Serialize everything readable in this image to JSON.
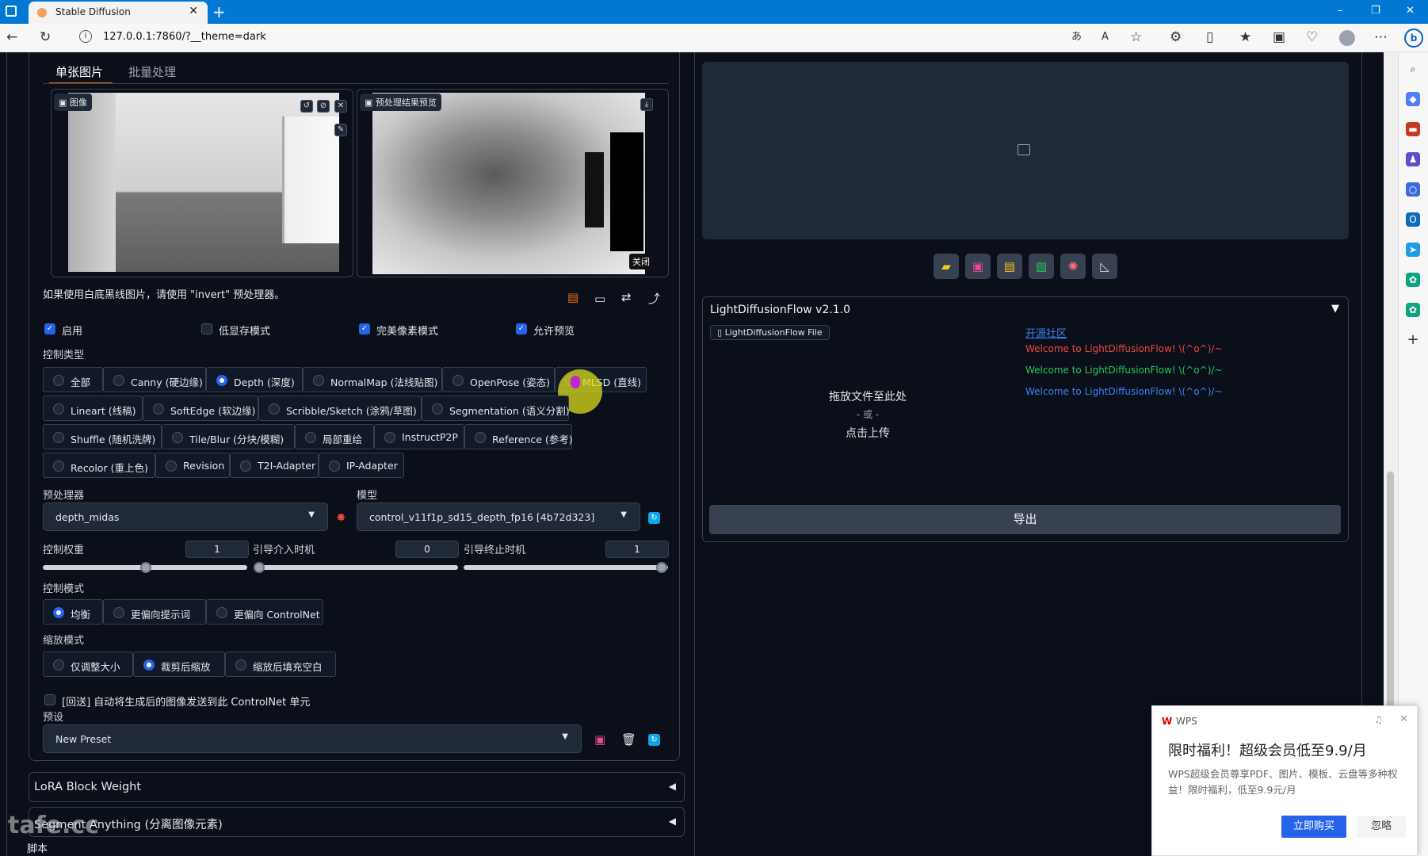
{
  "browser": {
    "tab_title": "Stable Diffusion",
    "new_tab": "+",
    "address": "127.0.0.1:7860/?__theme=dark",
    "nav_icons": [
      "back-icon",
      "refresh-icon",
      "info-icon"
    ],
    "window_buttons": [
      "–",
      "❐",
      "✕"
    ]
  },
  "left": {
    "tabs": [
      "单张图片",
      "批量处理"
    ],
    "image_label": "图像",
    "preview_label": "预处理结果预览",
    "close_label": "关闭",
    "hint": "如果使用白底黑线图片，请使用 \"invert\" 预处理器。",
    "checkboxes": [
      {
        "label": "启用",
        "checked": true
      },
      {
        "label": "低显存模式",
        "checked": false
      },
      {
        "label": "完美像素模式",
        "checked": true
      },
      {
        "label": "允许预览",
        "checked": true
      }
    ],
    "control_type_label": "控制类型",
    "control_types": [
      [
        "全部",
        "Canny (硬边缘)",
        "Depth (深度)",
        "NormalMap (法线贴图)",
        "OpenPose (姿态)",
        "MLSD (直线)"
      ],
      [
        "Lineart (线稿)",
        "SoftEdge (软边缘)",
        "Scribble/Sketch (涂鸦/草图)",
        "Segmentation (语义分割)"
      ],
      [
        "Shuffle (随机洗牌)",
        "Tile/Blur (分块/模糊)",
        "局部重绘",
        "InstructP2P",
        "Reference (参考)"
      ],
      [
        "Recolor (重上色)",
        "Revision",
        "T2I-Adapter",
        "IP-Adapter"
      ]
    ],
    "control_type_selected": "Depth (深度)",
    "preprocessor_label": "预处理器",
    "preprocessor_value": "depth_midas",
    "model_label": "模型",
    "model_value": "control_v11f1p_sd15_depth_fp16 [4b72d323]",
    "weight_label": "控制权重",
    "weight_value": "1",
    "start_label": "引导介入时机",
    "start_value": "0",
    "end_label": "引导终止时机",
    "end_value": "1",
    "control_mode_label": "控制模式",
    "control_modes": [
      "均衡",
      "更偏向提示词",
      "更偏向 ControlNet"
    ],
    "control_mode_selected": "均衡",
    "resize_mode_label": "缩放模式",
    "resize_modes": [
      "仅调整大小",
      "裁剪后缩放",
      "缩放后填充空白"
    ],
    "resize_mode_selected": "裁剪后缩放",
    "loopback_label": "[回送] 自动将生成后的图像发送到此 ControlNet 单元",
    "preset_label": "预设",
    "preset_value": "New Preset",
    "accordions": [
      "LoRA Block Weight",
      "Segment Anything (分离图像元素)"
    ],
    "script_label": "脚本"
  },
  "right": {
    "ldf_title": "LightDiffusionFlow v2.1.0",
    "ldf_file_label": "LightDiffusionFlow File",
    "drop_text": "拖放文件至此处",
    "or_text": "- 或 -",
    "click_upload": "点击上传",
    "community_link": "开源社区",
    "welcome": "Welcome to LightDiffusionFlow! \\(^o^)/~",
    "welcome_colors": [
      "#ef4444",
      "#22c55e",
      "#3b82f6"
    ],
    "export_label": "导出",
    "toolbar_icons": [
      "folder-icon",
      "save-icon",
      "zip-icon",
      "image-icon",
      "palette-icon",
      "ruler-icon"
    ]
  },
  "wps": {
    "brand": "WPS",
    "headline": "限时福利！超级会员低至9.9/月",
    "body": "WPS超级会员尊享PDF、图片、模板、云盘等多种权益！限时福利，低至9.9元/月",
    "buy": "立即购买",
    "ignore": "忽略"
  },
  "watermark": "tafe.cc"
}
